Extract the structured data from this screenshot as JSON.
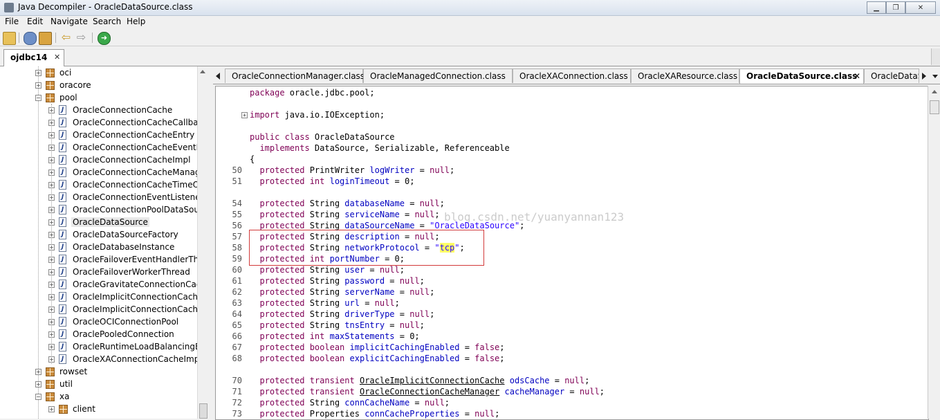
{
  "window": {
    "title": "Java Decompiler - OracleDataSource.class"
  },
  "menu": [
    "File",
    "Edit",
    "Navigate",
    "Search",
    "Help"
  ],
  "project_tab": {
    "label": "ojdbc14",
    "close": "✕"
  },
  "tree": [
    {
      "label": "oci",
      "kind": "package",
      "expander": "+"
    },
    {
      "label": "oracore",
      "kind": "package",
      "expander": "+"
    },
    {
      "label": "pool",
      "kind": "package",
      "expander": "−"
    },
    {
      "label": "OracleConnectionCache",
      "kind": "class",
      "expander": "+"
    },
    {
      "label": "OracleConnectionCacheCallback",
      "kind": "class",
      "expander": "+"
    },
    {
      "label": "OracleConnectionCacheEntry",
      "kind": "class",
      "expander": "+"
    },
    {
      "label": "OracleConnectionCacheEventListe",
      "kind": "class",
      "expander": "+"
    },
    {
      "label": "OracleConnectionCacheImpl",
      "kind": "class",
      "expander": "+"
    },
    {
      "label": "OracleConnectionCacheManager",
      "kind": "class",
      "expander": "+"
    },
    {
      "label": "OracleConnectionCacheTimeOutT",
      "kind": "class",
      "expander": "+"
    },
    {
      "label": "OracleConnectionEventListener",
      "kind": "class",
      "expander": "+"
    },
    {
      "label": "OracleConnectionPoolDataSource",
      "kind": "class",
      "expander": "+"
    },
    {
      "label": "OracleDataSource",
      "kind": "class",
      "expander": "+",
      "selected": true
    },
    {
      "label": "OracleDataSourceFactory",
      "kind": "class",
      "expander": "+"
    },
    {
      "label": "OracleDatabaseInstance",
      "kind": "class",
      "expander": "+"
    },
    {
      "label": "OracleFailoverEventHandlerThreac",
      "kind": "class",
      "expander": "+"
    },
    {
      "label": "OracleFailoverWorkerThread",
      "kind": "class",
      "expander": "+"
    },
    {
      "label": "OracleGravitateConnectionCacheT",
      "kind": "class",
      "expander": "+"
    },
    {
      "label": "OracleImplicitConnectionCache",
      "kind": "class",
      "expander": "+"
    },
    {
      "label": "OracleImplicitConnectionCacheTh",
      "kind": "class",
      "expander": "+"
    },
    {
      "label": "OracleOCIConnectionPool",
      "kind": "class",
      "expander": "+"
    },
    {
      "label": "OraclePooledConnection",
      "kind": "class",
      "expander": "+"
    },
    {
      "label": "OracleRuntimeLoadBalancingEver",
      "kind": "class",
      "expander": "+"
    },
    {
      "label": "OracleXAConnectionCacheImpl",
      "kind": "class",
      "expander": "+"
    },
    {
      "label": "rowset",
      "kind": "package",
      "expander": "+"
    },
    {
      "label": "util",
      "kind": "package",
      "expander": "+"
    },
    {
      "label": "xa",
      "kind": "package",
      "expander": "−"
    },
    {
      "label": "client",
      "kind": "package",
      "expander": "+"
    }
  ],
  "code_tabs": [
    {
      "label": "OracleConnectionManager.class"
    },
    {
      "label": "OracleManagedConnection.class"
    },
    {
      "label": "OracleXAConnection.class"
    },
    {
      "label": "OracleXAResource.class"
    },
    {
      "label": "OracleDataSource.class",
      "active": true,
      "close": "✕"
    },
    {
      "label": "OracleDataSo"
    }
  ],
  "watermark": "blog.csdn.net/yuanyannan123",
  "code": [
    {
      "ln": "",
      "html": "<span class=\"kw\">package</span> oracle.jdbc.pool;"
    },
    {
      "ln": "",
      "html": ""
    },
    {
      "ln": "",
      "html": "<span class=\"kw\">import</span> java.io.IOException;",
      "fold": "+"
    },
    {
      "ln": "",
      "html": ""
    },
    {
      "ln": "",
      "html": "<span class=\"kw\">public class</span> OracleDataSource"
    },
    {
      "ln": "",
      "html": "  <span class=\"kw\">implements</span> DataSource, Serializable, Referenceable"
    },
    {
      "ln": "",
      "html": "{"
    },
    {
      "ln": "50",
      "html": "  <span class=\"kw\">protected</span> PrintWriter <span class=\"fld\">logWriter</span> = <span class=\"kw\">null</span>;"
    },
    {
      "ln": "51",
      "html": "  <span class=\"kw\">protected int</span> <span class=\"fld\">loginTimeout</span> = 0;"
    },
    {
      "ln": "",
      "html": ""
    },
    {
      "ln": "54",
      "html": "  <span class=\"kw\">protected</span> String <span class=\"fld\">databaseName</span> = <span class=\"kw\">null</span>;"
    },
    {
      "ln": "55",
      "html": "  <span class=\"kw\">protected</span> String <span class=\"fld\">serviceName</span> = <span class=\"kw\">null</span>;"
    },
    {
      "ln": "56",
      "html": "  <span class=\"kw\">protected</span> String <span class=\"fld\">dataSourceName</span> = <span class=\"str\">\"OracleDataSource\"</span>;"
    },
    {
      "ln": "57",
      "html": "  <span class=\"kw\">protected</span> String <span class=\"fld\">description</span> = <span class=\"kw\">null</span>;"
    },
    {
      "ln": "58",
      "html": "  <span class=\"kw\">protected</span> String <span class=\"fld\">networkProtocol</span> = <span class=\"str\">\"<span class=\"hl\">tcp</span>\"</span>;"
    },
    {
      "ln": "59",
      "html": "  <span class=\"kw\">protected int</span> <span class=\"fld\">portNumber</span> = 0;"
    },
    {
      "ln": "60",
      "html": "  <span class=\"kw\">protected</span> String <span class=\"fld\">user</span> = <span class=\"kw\">null</span>;"
    },
    {
      "ln": "61",
      "html": "  <span class=\"kw\">protected</span> String <span class=\"fld\">password</span> = <span class=\"kw\">null</span>;"
    },
    {
      "ln": "62",
      "html": "  <span class=\"kw\">protected</span> String <span class=\"fld\">serverName</span> = <span class=\"kw\">null</span>;"
    },
    {
      "ln": "63",
      "html": "  <span class=\"kw\">protected</span> String <span class=\"fld\">url</span> = <span class=\"kw\">null</span>;"
    },
    {
      "ln": "64",
      "html": "  <span class=\"kw\">protected</span> String <span class=\"fld\">driverType</span> = <span class=\"kw\">null</span>;"
    },
    {
      "ln": "65",
      "html": "  <span class=\"kw\">protected</span> String <span class=\"fld\">tnsEntry</span> = <span class=\"kw\">null</span>;"
    },
    {
      "ln": "66",
      "html": "  <span class=\"kw\">protected int</span> <span class=\"fld\">maxStatements</span> = 0;"
    },
    {
      "ln": "67",
      "html": "  <span class=\"kw\">protected boolean</span> <span class=\"fld\">implicitCachingEnabled</span> = <span class=\"kw\">false</span>;"
    },
    {
      "ln": "68",
      "html": "  <span class=\"kw\">protected boolean</span> <span class=\"fld\">explicitCachingEnabled</span> = <span class=\"kw\">false</span>;"
    },
    {
      "ln": "",
      "html": ""
    },
    {
      "ln": "70",
      "html": "  <span class=\"kw\">protected transient</span> <span class=\"typ\">OracleImplicitConnectionCache</span> <span class=\"fld\">odsCache</span> = <span class=\"kw\">null</span>;"
    },
    {
      "ln": "71",
      "html": "  <span class=\"kw\">protected transient</span> <span class=\"typ\">OracleConnectionCacheManager</span> <span class=\"fld\">cacheManager</span> = <span class=\"kw\">null</span>;"
    },
    {
      "ln": "72",
      "html": "  <span class=\"kw\">protected</span> String <span class=\"fld\">connCacheName</span> = <span class=\"kw\">null</span>;"
    },
    {
      "ln": "73",
      "html": "  <span class=\"kw\">protected</span> Properties <span class=\"fld\">connCacheProperties</span> = <span class=\"kw\">null</span>;"
    }
  ],
  "colors": {
    "keyword": "#7f0055",
    "field": "#0000c0",
    "string": "#2a00ff",
    "highlight": "#ffff66",
    "annotation_box": "#d23a3a"
  }
}
